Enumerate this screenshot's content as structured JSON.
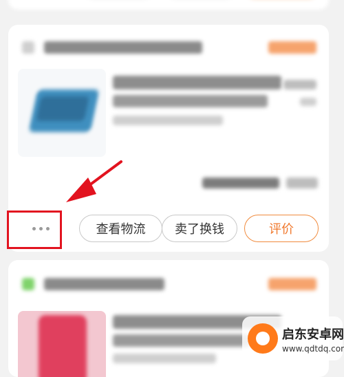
{
  "order_card": {
    "actions": {
      "more_label": "···",
      "view_logistics_label": "查看物流",
      "sell_for_cash_label": "卖了换钱",
      "review_label": "评价"
    }
  },
  "watermark": {
    "title": "启东安卓网",
    "url": "www.qdtdq.com"
  },
  "colors": {
    "accent": "#f0782c",
    "annotation_red": "#e2131f"
  }
}
